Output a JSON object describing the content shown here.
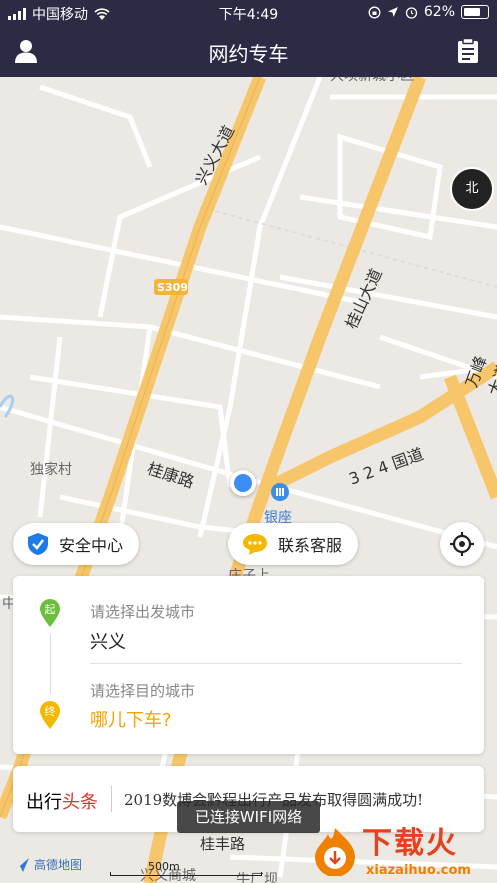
{
  "status_bar": {
    "carrier": "中国移动",
    "time": "下午4:49",
    "battery": "62%"
  },
  "nav": {
    "title": "网约专车",
    "user_icon": "user-icon",
    "orders_icon": "clipboard-icon"
  },
  "map": {
    "labels": {
      "xingyi_ave": "兴义大道",
      "guishan_ave": "桂山大道",
      "wanfeng_ave": "万峰大道",
      "road_324": "3 2 4 国道",
      "guikang_rd": "桂康路",
      "dujiacun": "独家村",
      "s309": "S309",
      "yinzuo": "银座",
      "guifeng_rd": "桂丰路",
      "tag_zhong": "中",
      "top_cut": "大坝新城小区",
      "bottom_cut": "兴义商城",
      "bottom_cut2": "牛厂坝",
      "mid_cut": "庄子上"
    },
    "compass_label": "北",
    "scale": "500m",
    "provider": "高德地图"
  },
  "actions": {
    "safety_center": "安全中心",
    "contact_service": "联系客服"
  },
  "trip": {
    "from_placeholder": "请选择出发城市",
    "from_value": "兴义",
    "from_marker": "起",
    "to_placeholder": "请选择目的城市",
    "to_value": "哪儿下车?",
    "to_marker": "终"
  },
  "news": {
    "label_part1": "出行",
    "label_part2": "头条",
    "text": "2019数博会黔程出行产品发布取得圆满成功!"
  },
  "toast": "已连接WIFI网络",
  "watermark": {
    "brand": "下载火",
    "domain": "xiazaihuo.com"
  },
  "colors": {
    "nav_bg": "#2b2b45",
    "main_road": "#f7c66a",
    "accent_green": "#6bbf3a",
    "accent_yellow": "#f5b800",
    "accent_blue": "#1e7ae6"
  }
}
